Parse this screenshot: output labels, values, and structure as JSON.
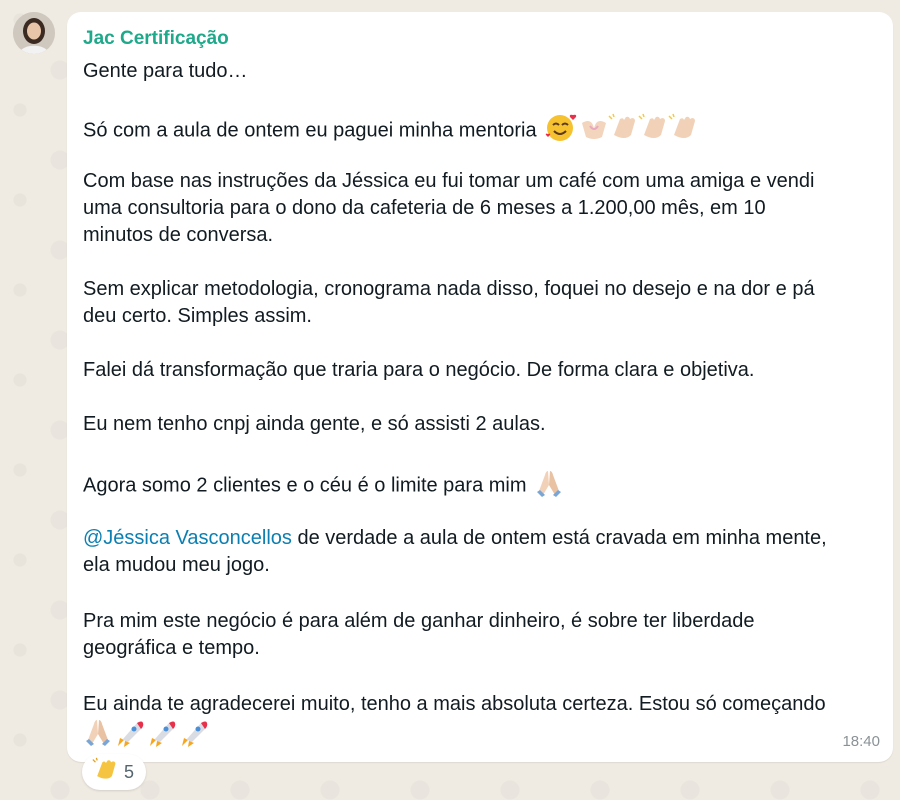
{
  "message": {
    "sender": "Jac Certificação",
    "lines": {
      "l1": "Gente para tudo…",
      "l2": "Só com a aula de ontem eu paguei minha mentoria",
      "l3": "Com base nas instruções da Jéssica eu fui tomar um café com uma amiga e vendi",
      "l4": "uma consultoria para o dono da cafeteria de 6 meses a 1.200,00 mês, em 10",
      "l5": "minutos de conversa.",
      "l6": "Sem explicar metodologia, cronograma nada disso, foquei no desejo e na dor e pá",
      "l7": "deu certo. Simples assim.",
      "l8": "Falei dá transformação que traria para o negócio. De forma clara e objetiva.",
      "l9": "Eu nem tenho cnpj ainda gente, e só assisti 2 aulas.",
      "l10": "Agora somo 2 clientes e o céu é o limite para mim",
      "l11_mention": "@Jéssica Vasconcellos",
      "l11_rest": " de verdade a aula de ontem está cravada em minha mente,",
      "l12": "ela mudou meu jogo.",
      "l13": "Pra mim este negócio é para além de ganhar dinheiro, é sobre ter liberdade",
      "l14": "geográfica e tempo.",
      "l15": "Eu ainda te agradecerei muito, tenho a mais absoluta certeza. Estou só começando"
    },
    "time": "18:40"
  },
  "reaction": {
    "icon": "clapping-hands-icon",
    "count": "5"
  },
  "colors": {
    "sender": "#1fa98a",
    "mention": "#0b7fb2",
    "background": "#efeae2"
  }
}
